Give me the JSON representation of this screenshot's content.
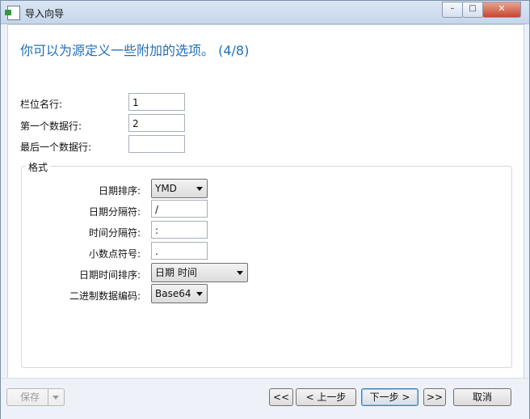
{
  "window": {
    "title": "导入向导",
    "controls": {
      "minimize": "–",
      "maximize": "□",
      "close": "✕"
    }
  },
  "page": {
    "heading": "你可以为源定义一些附加的选项。 (4/8)"
  },
  "fields": {
    "field_name_row": {
      "label": "栏位名行:",
      "value": "1"
    },
    "first_data_row": {
      "label": "第一个数据行:",
      "value": "2"
    },
    "last_data_row": {
      "label": "最后一个数据行:",
      "value": ""
    }
  },
  "format": {
    "legend": "格式",
    "date_order": {
      "label": "日期排序:",
      "value": "YMD"
    },
    "date_delimiter": {
      "label": "日期分隔符:",
      "value": "/"
    },
    "time_delimiter": {
      "label": "时间分隔符:",
      "value": ":"
    },
    "decimal_symbol": {
      "label": "小数点符号:",
      "value": "."
    },
    "datetime_order": {
      "label": "日期时间排序:",
      "value": "日期 时间"
    },
    "binary_encoding": {
      "label": "二进制数据编码:",
      "value": "Base64"
    }
  },
  "footer": {
    "save": "保存",
    "first": "<<",
    "prev": "< 上一步",
    "next": "下一步 >",
    "last": ">>",
    "cancel": "取消"
  }
}
